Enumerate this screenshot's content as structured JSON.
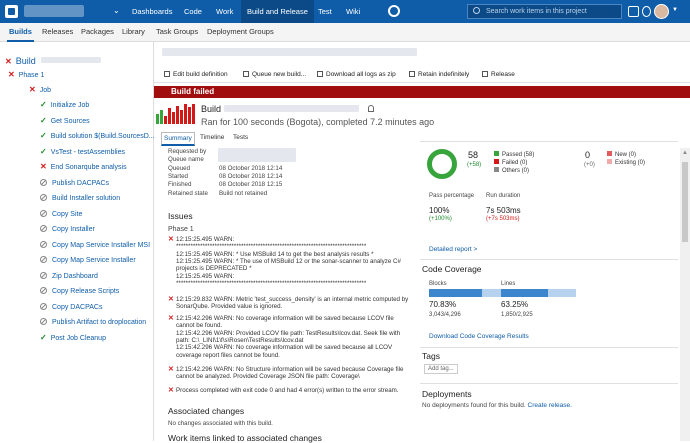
{
  "topbar": {
    "nav": [
      "Dashboards",
      "Code",
      "Work",
      "Build and Release",
      "Test",
      "Wiki"
    ],
    "search_placeholder": "Search work items in this project"
  },
  "subnav": [
    "Builds",
    "Releases",
    "Packages",
    "Library",
    "Task Groups",
    "Deployment Groups"
  ],
  "sidebar": {
    "root": "Build",
    "phase": "Phase 1",
    "job": "Job",
    "steps": [
      {
        "label": "Initialize Job",
        "status": "succeeded"
      },
      {
        "label": "Get Sources",
        "status": "succeeded"
      },
      {
        "label": "Build solution $(Build.SourcesD...",
        "status": "succeeded"
      },
      {
        "label": "VsTest - testAssemblies",
        "status": "succeeded"
      },
      {
        "label": "End Sonarqube analysis",
        "status": "failed"
      },
      {
        "label": "Publish DACPACs",
        "status": "skipped"
      },
      {
        "label": "Build Installer solution",
        "status": "skipped"
      },
      {
        "label": "Copy Site",
        "status": "skipped"
      },
      {
        "label": "Copy Installer",
        "status": "skipped"
      },
      {
        "label": "Copy Map Service Installer MSI",
        "status": "skipped"
      },
      {
        "label": "Copy Map Service Installer",
        "status": "skipped"
      },
      {
        "label": "Zip Dashboard",
        "status": "skipped"
      },
      {
        "label": "Copy Release Scripts",
        "status": "skipped"
      },
      {
        "label": "Copy DACPACs",
        "status": "skipped"
      },
      {
        "label": "Publish Artifact to droplocation",
        "status": "skipped"
      },
      {
        "label": "Post Job Cleanup",
        "status": "succeeded"
      }
    ]
  },
  "toolbar": {
    "edit": "Edit build definition",
    "queue": "Queue new build...",
    "download": "Download all logs as zip",
    "retain": "Retain indefinitely",
    "release": "Release"
  },
  "banner": "Build failed",
  "header": {
    "title": "Build",
    "ran": "Ran for 100 seconds (Bogota), completed 7.2 minutes ago"
  },
  "detail_tabs": [
    "Summary",
    "Timeline",
    "Tests"
  ],
  "details": [
    {
      "k": "Requested by",
      "v": ""
    },
    {
      "k": "Queue name",
      "v": ""
    },
    {
      "k": "Queued",
      "v": "08 October 2018 12:14"
    },
    {
      "k": "Started",
      "v": "08 October 2018 12:14"
    },
    {
      "k": "Finished",
      "v": "08 October 2018 12:15"
    },
    {
      "k": "Retained state",
      "v": "Build not retained"
    }
  ],
  "issues": {
    "title": "Issues",
    "phase": "Phase 1",
    "blocks": [
      [
        "12:15:25.495 WARN:",
        "*******************************************************************************",
        "12:15:25.495 WARN: * Use MSBuild 14 to get the best analysis results *",
        "12:15:25.495 WARN: * The use of MSBuild 12 or the sonar-scanner to analyze C#",
        "projects is DEPRECATED *",
        "12:15:25.495 WARN:",
        "*******************************************************************************"
      ],
      [
        "12:15:29.832 WARN: Metric 'test_success_density' is an internal metric computed by",
        "SonarQube. Provided value is ignored."
      ],
      [
        "12:15:42.296 WARN: No coverage information will be saved because LCOV file",
        "cannot be found.",
        "12:15:42.296 WARN: Provided LCOV file path: TestResults\\lcov.dat. Seek file with",
        "path: C:\\_LINI\\1\\f\\s\\Rosen\\TestResults\\lcov.dat",
        "12:15:42.296 WARN: No coverage information will be saved because all LCOV",
        "coverage report files cannot be found."
      ],
      [
        "12:15:42.296 WARN: No Structure information will be saved because Coverage file",
        "cannot be analyzed. Provided Coverage JSON file path: Coverage\\"
      ],
      [
        "Process completed with exit code 0 and had 4 error(s) written to the error stream."
      ]
    ]
  },
  "associated_changes": {
    "title": "Associated changes",
    "text": "No changes associated with this build."
  },
  "work_items": {
    "title": "Work items linked to associated changes"
  },
  "tests": {
    "total": "58",
    "total_delta": "(+58)",
    "passed": "Passed (58)",
    "failed": "Failed (0)",
    "others": "Others (0)",
    "new_count": "0",
    "new_delta": "(+0)",
    "new": "New (0)",
    "existing": "Existing (0)",
    "pass_pct_label": "Pass percentage",
    "pass_pct": "100%",
    "pass_pct_delta": "(+100%)",
    "duration_label": "Run duration",
    "duration": "7s 503ms",
    "duration_delta": "(+7s 503ms)",
    "detailed_report": "Detailed report >",
    "pass_fraction": 1.0,
    "colors": {
      "passed": "#37a43c",
      "failed": "#d41919",
      "others": "#888888",
      "new": "#e05b5b",
      "existing": "#f2a9a9"
    }
  },
  "coverage": {
    "title": "Code Coverage",
    "blocks_label": "Blocks",
    "blocks_pct": "70.83%",
    "blocks_frac": "3,043/4,296",
    "blocks_value": 0.7083,
    "lines_label": "Lines",
    "lines_pct": "63.25%",
    "lines_frac": "1,850/2,925",
    "lines_value": 0.6325,
    "download": "Download Code Coverage Results"
  },
  "tags": {
    "title": "Tags",
    "add": "Add tag..."
  },
  "deployments": {
    "title": "Deployments",
    "text": "No deployments found for this build.",
    "link": "Create release."
  }
}
